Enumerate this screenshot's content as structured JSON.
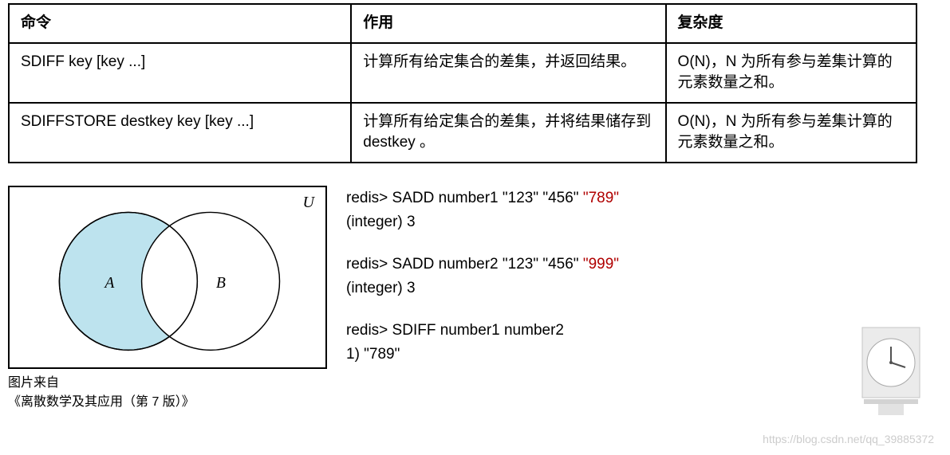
{
  "table": {
    "headers": [
      "命令",
      "作用",
      "复杂度"
    ],
    "rows": [
      {
        "cmd": "SDIFF key [key ...]",
        "desc": "计算所有给定集合的差集，并返回结果。",
        "complexity": "O(N)，N 为所有参与差集计算的元素数量之和。"
      },
      {
        "cmd": "SDIFFSTORE destkey key [key ...]",
        "desc": "计算所有给定集合的差集，并将结果储存到 destkey 。",
        "complexity": "O(N)，N 为所有参与差集计算的元素数量之和。"
      }
    ]
  },
  "venn": {
    "U_label": "U",
    "A_label": "A",
    "B_label": "B",
    "caption_line1": "图片来自",
    "caption_line2": "《离散数学及其应用（第 7 版）》"
  },
  "code": {
    "l1_prefix": "redis> SADD number1 \"123\" \"456\" ",
    "l1_red": "\"789\"",
    "l2": "(integer) 3",
    "l3_prefix": "redis> SADD number2 \"123\" \"456\" ",
    "l3_red": "\"999\"",
    "l4": "(integer) 3",
    "l5": "redis> SDIFF number1 number2",
    "l6": "1) \"789\""
  },
  "watermark": "https://blog.csdn.net/qq_39885372"
}
